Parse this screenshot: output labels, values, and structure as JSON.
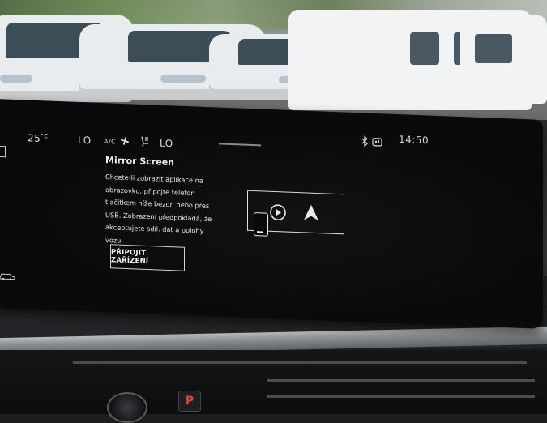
{
  "status_bar": {
    "temperature_left": "25",
    "temperature_unit": "°C",
    "fan_left": "LO",
    "ac_label": "A/C",
    "fan_right": "LO",
    "clock": "14:50",
    "icons": [
      "bluetooth-icon",
      "signal-icon"
    ]
  },
  "mirror_screen": {
    "title": "Mirror Screen",
    "body_lines": [
      "Chcete-li zobrazit aplikace na",
      "obrazovku, připojte telefon",
      "tlačítkem níže bezdr. nebo přes",
      "USB. Zobrazení předpokládá, že",
      "akceptujete sdíl. dat a polohy",
      "vozu."
    ],
    "connect_button": "PŘIPOJIT ZAŘÍZENÍ",
    "illustration_icons": [
      "phone-icon",
      "carplay-icon",
      "android-auto-icon"
    ]
  },
  "dashboard": {
    "p_button": "P"
  },
  "colors": {
    "screen_bg": "#09090b",
    "screen_text": "#e7e7e7",
    "car_white": "#e9ecee",
    "dashboard_dark": "#1b1d1f"
  }
}
